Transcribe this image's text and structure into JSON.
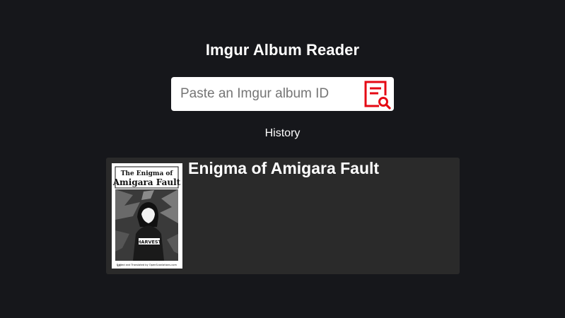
{
  "header": {
    "title": "Imgur Album Reader"
  },
  "search": {
    "placeholder": "Paste an Imgur album ID",
    "value": "",
    "button_icon": "search-document-icon",
    "accent_color": "#e50914"
  },
  "history": {
    "label": "History",
    "items": [
      {
        "title": "Enigma of Amigara Fault",
        "thumbnail": {
          "title_line1": "The Enigma of",
          "title_line2": "Amigara Fault",
          "shirt_text": "HARVEST",
          "caption": "Edited and Translated by OpenScanlations.com",
          "page_number": "1/1"
        }
      }
    ]
  }
}
